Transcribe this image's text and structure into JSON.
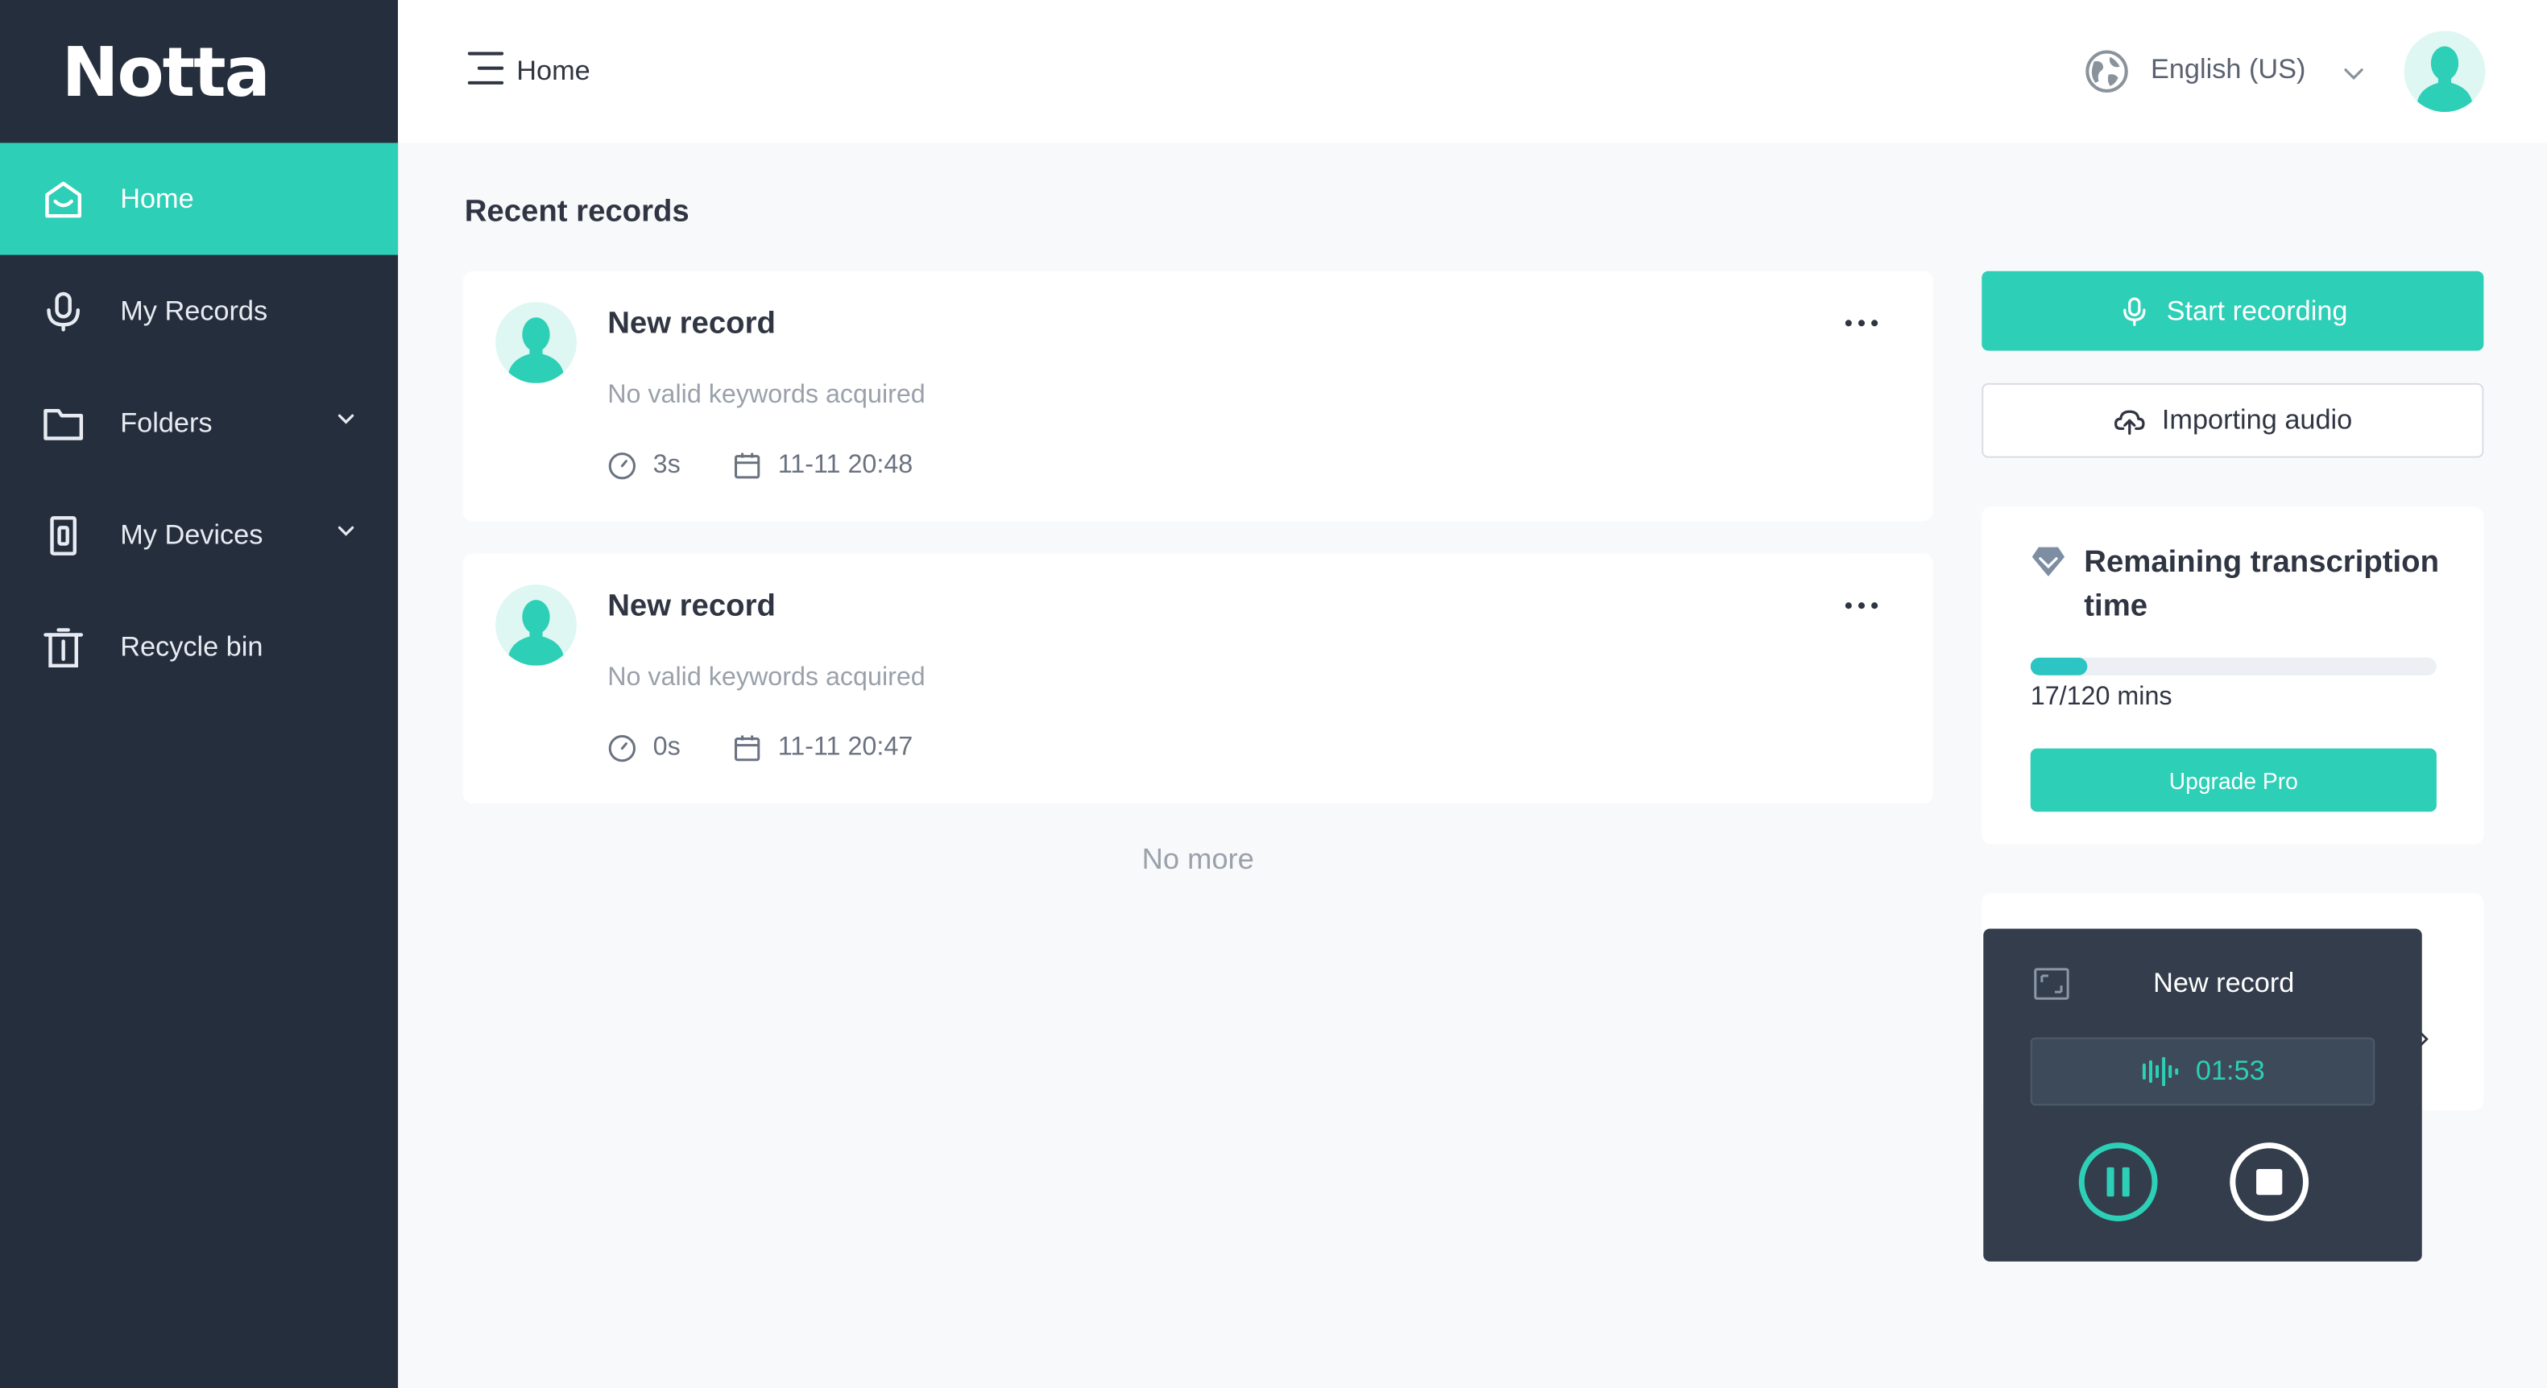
{
  "app": {
    "logo": "Notta"
  },
  "sidebar": {
    "items": [
      {
        "label": "Home",
        "icon": "home-icon",
        "active": true
      },
      {
        "label": "My Records",
        "icon": "microphone-icon"
      },
      {
        "label": "Folders",
        "icon": "folder-icon",
        "expandable": true
      },
      {
        "label": "My Devices",
        "icon": "device-icon",
        "expandable": true
      },
      {
        "label": "Recycle bin",
        "icon": "trash-icon"
      }
    ]
  },
  "header": {
    "title": "Home",
    "language": "English (US)"
  },
  "main": {
    "section_title": "Recent records",
    "records": [
      {
        "title": "New record",
        "keywords": "No valid keywords acquired",
        "duration": "3s",
        "date": "11-11 20:48"
      },
      {
        "title": "New record",
        "keywords": "No valid keywords acquired",
        "duration": "0s",
        "date": "11-11 20:47"
      }
    ],
    "end_text": "No more"
  },
  "actions": {
    "start_recording": "Start recording",
    "importing_audio": "Importing audio"
  },
  "quota": {
    "title": "Remaining transcription time",
    "used": 17,
    "total": 120,
    "text": "17/120 mins",
    "upgrade_label": "Upgrade Pro"
  },
  "recorder": {
    "title": "New record",
    "timer": "01:53"
  },
  "colors": {
    "sidebar_bg": "#252e3d",
    "accent": "#2dcfb6",
    "recorder_bg": "#333d4b"
  }
}
